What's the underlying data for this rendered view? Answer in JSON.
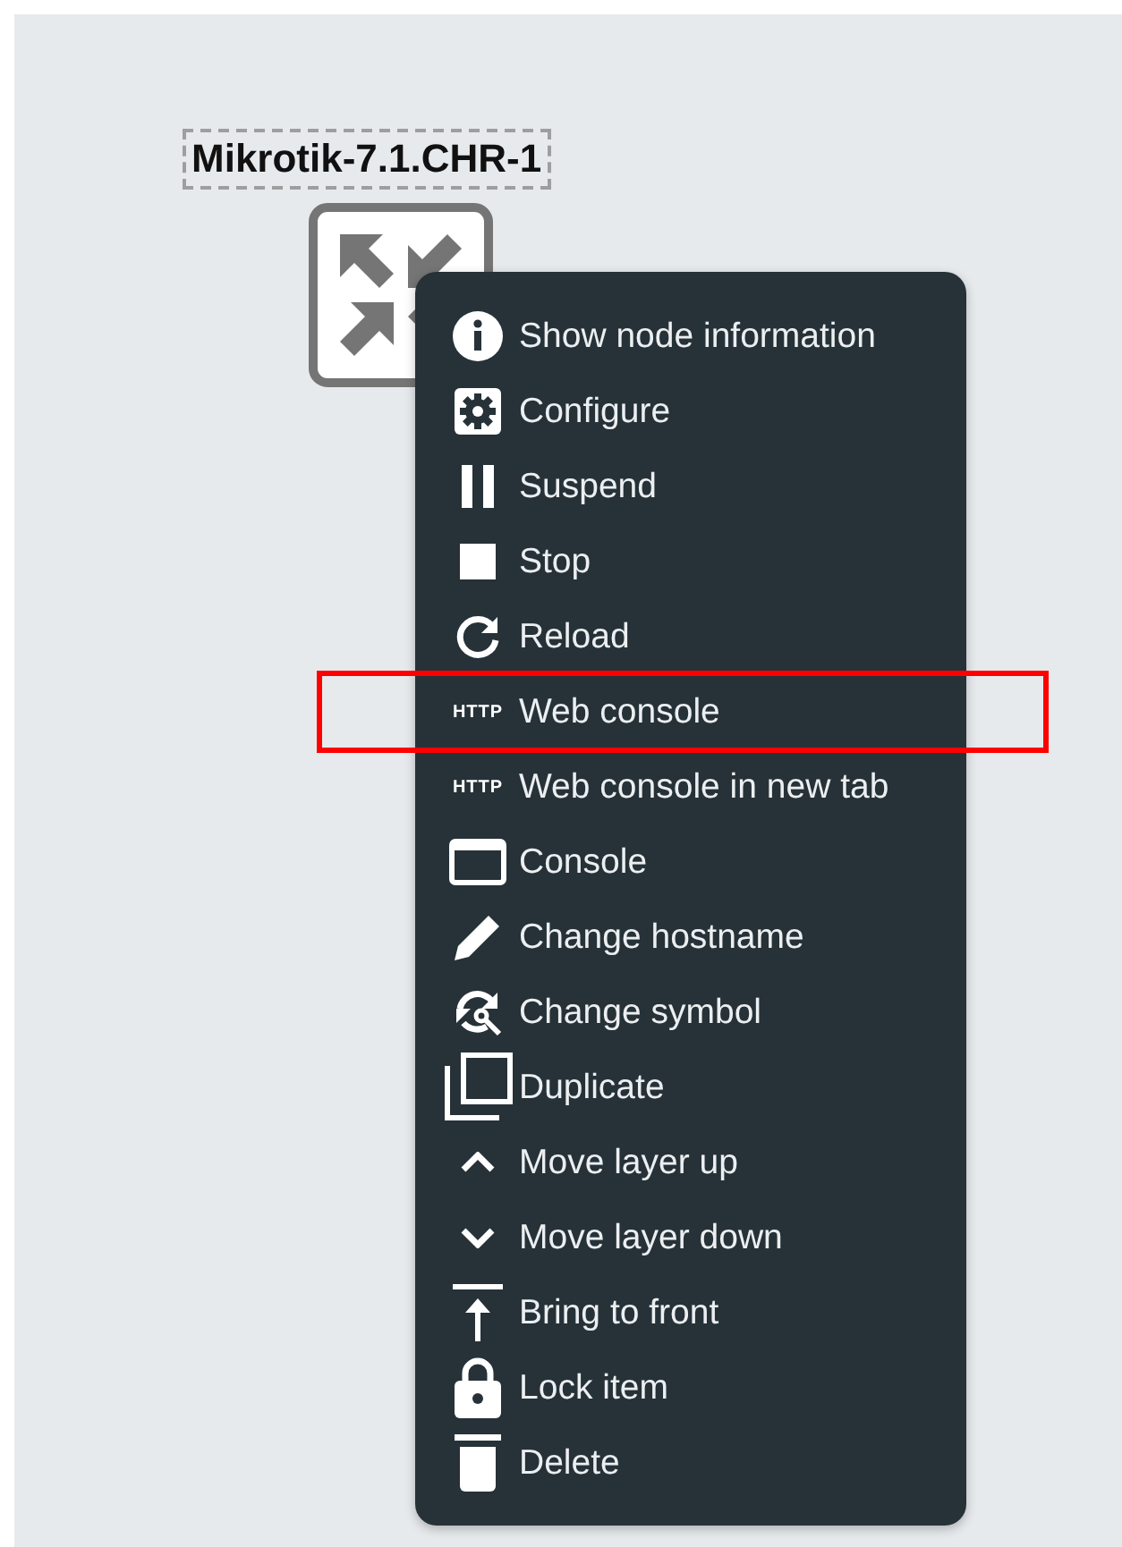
{
  "node": {
    "label": "Mikrotik-7.1.CHR-1",
    "selected": true
  },
  "context_menu": {
    "items": [
      {
        "label": "Show node information",
        "highlighted": false
      },
      {
        "label": "Configure",
        "highlighted": false
      },
      {
        "label": "Suspend",
        "highlighted": false
      },
      {
        "label": "Stop",
        "highlighted": false
      },
      {
        "label": "Reload",
        "highlighted": false
      },
      {
        "label": "Web console",
        "icon_text": "HTTP",
        "highlighted": true
      },
      {
        "label": "Web console in new tab",
        "icon_text": "HTTP",
        "highlighted": false
      },
      {
        "label": "Console",
        "highlighted": false
      },
      {
        "label": "Change hostname",
        "highlighted": false
      },
      {
        "label": "Change symbol",
        "highlighted": false
      },
      {
        "label": "Duplicate",
        "highlighted": false
      },
      {
        "label": "Move layer up",
        "highlighted": false
      },
      {
        "label": "Move layer down",
        "highlighted": false
      },
      {
        "label": "Bring to front",
        "highlighted": false
      },
      {
        "label": "Lock item",
        "highlighted": false
      },
      {
        "label": "Delete",
        "highlighted": false
      }
    ]
  }
}
